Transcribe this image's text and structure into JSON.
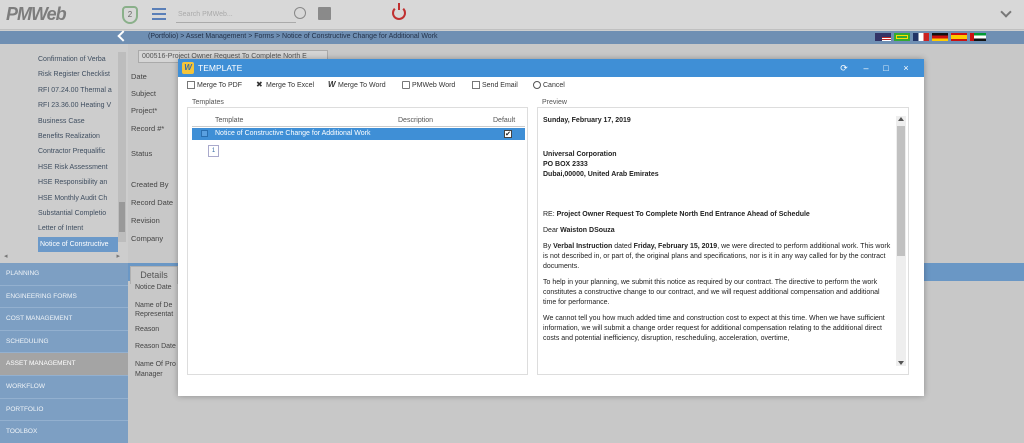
{
  "app": {
    "logo": "PMWeb",
    "shield_count": "2",
    "search_placeholder": "Search PMWeb..."
  },
  "breadcrumb": "(Portfolio) > Asset Management > Forms > Notice of Constructive Change for Additional Work",
  "sidebar": {
    "items": [
      "Confirmation of Verba",
      "Risk Register Checklist",
      "RFI 07.24.00 Thermal a",
      "RFI 23.36.00 Heating V",
      "Business Case",
      "Benefits Realization",
      "Contractor Prequalific",
      "HSE Risk Assessment",
      "HSE Responsibility an",
      "HSE Monthly Audit Ch",
      "Substantial Completio",
      "Letter of Intent",
      "Notice of Constructive"
    ],
    "active_index": 12,
    "modules": [
      "PLANNING",
      "ENGINEERING FORMS",
      "COST MANAGEMENT",
      "SCHEDULING",
      "ASSET MANAGEMENT",
      "WORKFLOW",
      "PORTFOLIO",
      "TOOLBOX"
    ]
  },
  "form": {
    "record_select": "000516-Project Owner Request To Complete North E",
    "labels": [
      "Date",
      "Subject",
      "Project*",
      "Record #*",
      "Status",
      "Created By",
      "Record Date",
      "Revision",
      "Company"
    ],
    "details_tab": "Details",
    "detail_labels": [
      "Notice Date",
      "Name of De",
      "Representat",
      "Reason",
      "Reason Date",
      "Name Of Pro",
      "Manager"
    ]
  },
  "modal": {
    "title": "TEMPLATE",
    "toolbar": [
      "Merge To PDF",
      "Merge To Excel",
      "Merge To Word",
      "PMWeb Word",
      "Send Email",
      "Cancel"
    ],
    "templates_label": "Templates",
    "preview_label": "Preview",
    "columns": {
      "template": "Template",
      "description": "Description",
      "default": "Default"
    },
    "row": {
      "name": "Notice of Constructive Change for Additional Work",
      "default_checked": "✔"
    },
    "page": "1",
    "preview": {
      "date": "Sunday, February 17, 2019",
      "addr1": "Universal Corporation",
      "addr2": "PO BOX 2333",
      "addr3": "Dubai,00000, United Arab Emirates",
      "re_prefix": "RE: ",
      "re_subject": "Project Owner Request To Complete North End Entrance Ahead of Schedule",
      "dear_prefix": "Dear ",
      "dear_name": "Waiston DSouza",
      "p1_a": "By ",
      "p1_b": "Verbal Instruction",
      "p1_c": " dated ",
      "p1_d": "Friday, February 15, 2019",
      "p1_e": ", we were directed to perform additional work. This work is not described in, or part of, the original plans and specifications, nor is it in any way called for by the contract documents.",
      "p2": "To help in your planning, we submit this notice as required by our contract. The directive to perform the work constitutes a constructive change to our contract, and we will request additional compensation and additional time for performance.",
      "p3": "We cannot tell you how much added time and construction cost to expect at this time. When we have sufficient information, we will submit a change order request for additional compensation relating to the additional direct costs and potential inefficiency, disruption, rescheduling, acceleration, overtime,"
    }
  },
  "colors": {
    "header_blue": "#3f8fd6",
    "module_blue": "#7d9fc3",
    "crumb_blue": "#6f8fb3"
  }
}
